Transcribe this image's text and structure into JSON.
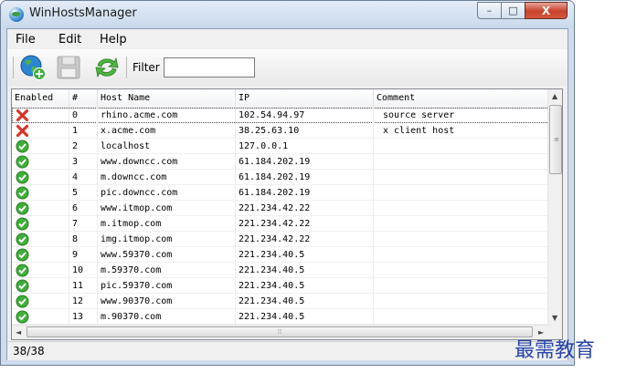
{
  "window": {
    "title": "WinHostsManager"
  },
  "controls": {
    "minimize": "–",
    "maximize": "□",
    "close": "X"
  },
  "menu": [
    "File",
    "Edit",
    "Help"
  ],
  "toolbar": {
    "filter_label": "Filter",
    "filter_value": ""
  },
  "table": {
    "columns": [
      "Enabled",
      "#",
      "Host Name",
      "IP",
      "Comment"
    ],
    "rows": [
      {
        "enabled": false,
        "num": "0",
        "host": "rhino.acme.com",
        "ip": "102.54.94.97",
        "comment": "source server"
      },
      {
        "enabled": false,
        "num": "1",
        "host": "x.acme.com",
        "ip": "38.25.63.10",
        "comment": "x client host"
      },
      {
        "enabled": true,
        "num": "2",
        "host": "localhost",
        "ip": "127.0.0.1",
        "comment": ""
      },
      {
        "enabled": true,
        "num": "3",
        "host": "www.downcc.com",
        "ip": "61.184.202.19",
        "comment": ""
      },
      {
        "enabled": true,
        "num": "4",
        "host": "m.downcc.com",
        "ip": "61.184.202.19",
        "comment": ""
      },
      {
        "enabled": true,
        "num": "5",
        "host": "pic.downcc.com",
        "ip": "61.184.202.19",
        "comment": ""
      },
      {
        "enabled": true,
        "num": "6",
        "host": "www.itmop.com",
        "ip": "221.234.42.22",
        "comment": ""
      },
      {
        "enabled": true,
        "num": "7",
        "host": "m.itmop.com",
        "ip": "221.234.42.22",
        "comment": ""
      },
      {
        "enabled": true,
        "num": "8",
        "host": "img.itmop.com",
        "ip": "221.234.42.22",
        "comment": ""
      },
      {
        "enabled": true,
        "num": "9",
        "host": "www.59370.com",
        "ip": "221.234.40.5",
        "comment": ""
      },
      {
        "enabled": true,
        "num": "10",
        "host": "m.59370.com",
        "ip": "221.234.40.5",
        "comment": ""
      },
      {
        "enabled": true,
        "num": "11",
        "host": "pic.59370.com",
        "ip": "221.234.40.5",
        "comment": ""
      },
      {
        "enabled": true,
        "num": "12",
        "host": "www.90370.com",
        "ip": "221.234.40.5",
        "comment": ""
      },
      {
        "enabled": true,
        "num": "13",
        "host": "m.90370.com",
        "ip": "221.234.40.5",
        "comment": ""
      }
    ]
  },
  "icons": {
    "enabled": "check-icon",
    "disabled": "x-icon",
    "add": "globe-add-icon",
    "save": "save-icon",
    "refresh": "refresh-icon"
  },
  "colors": {
    "enabled": "#3fae3a",
    "disabled": "#d9362b",
    "accent": "#2844a8"
  },
  "statusbar": {
    "count": "38/38"
  },
  "watermark": "最需教育"
}
